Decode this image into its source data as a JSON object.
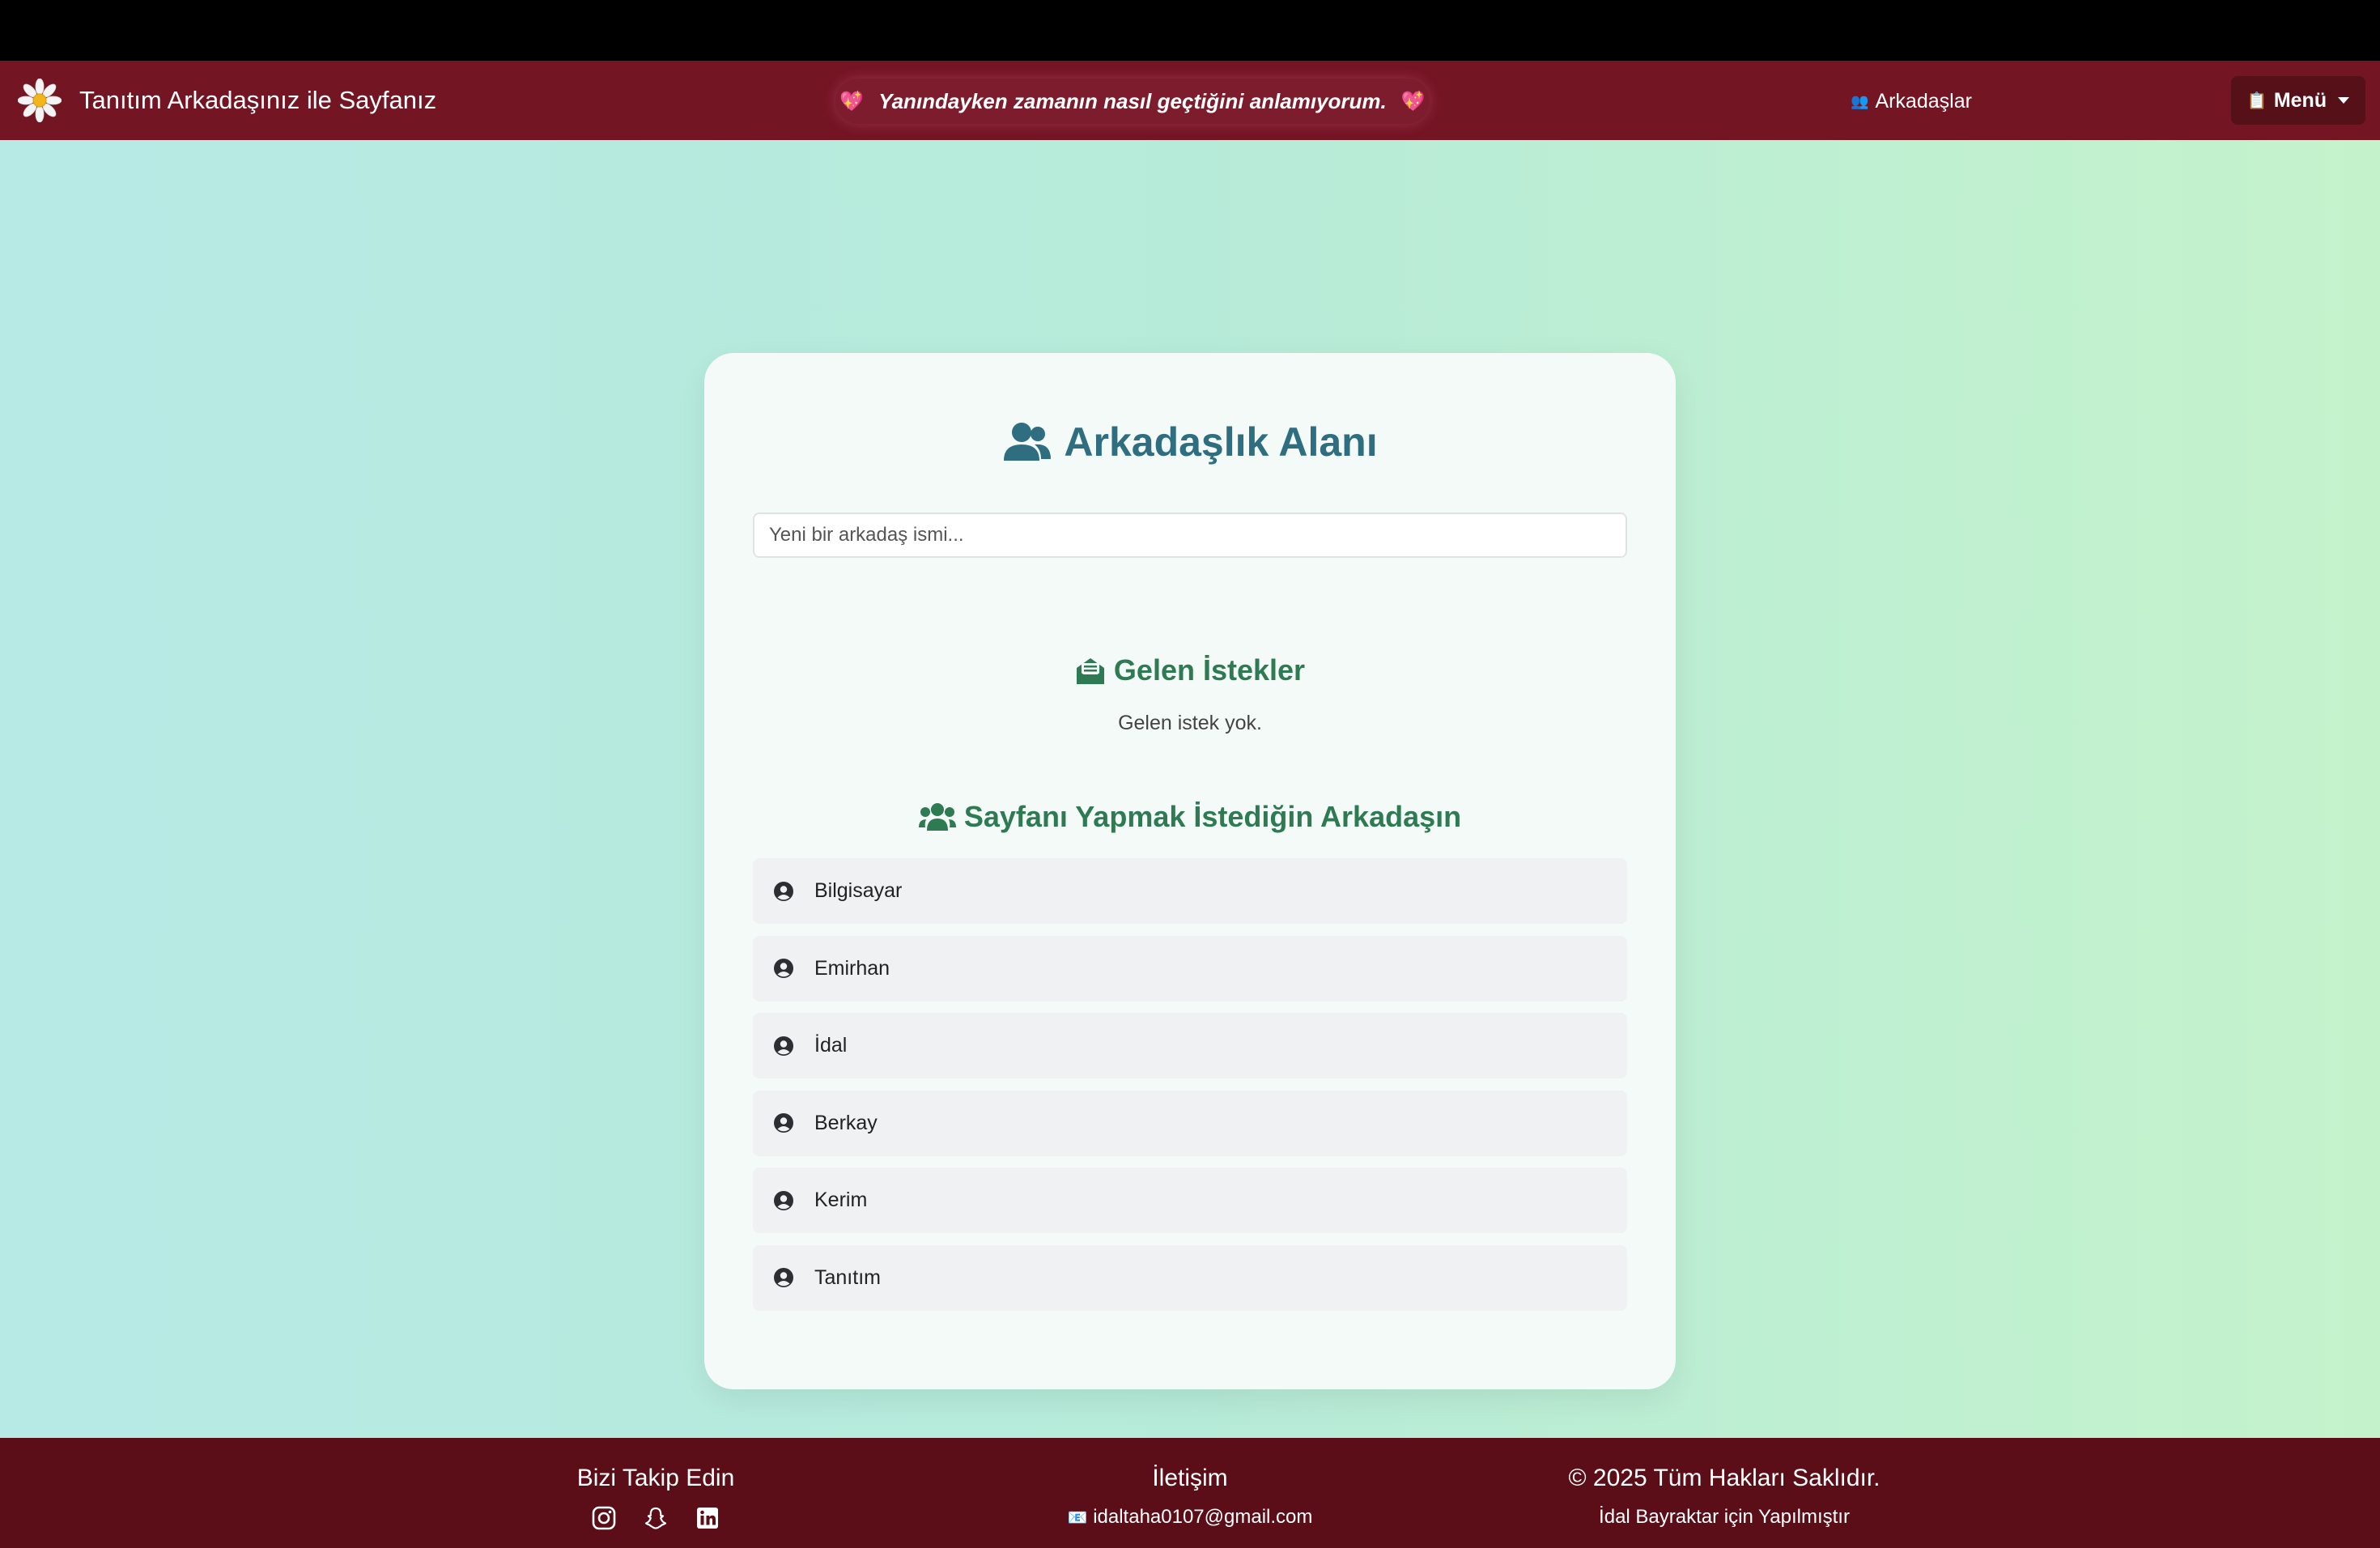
{
  "navbar": {
    "brand_title": "Tanıtım Arkadaşınız ile Sayfanız",
    "brand_icon": "daisy-flower-icon",
    "marquee_text": "Yanındayken zamanın nasıl geçtiğini anlamıyorum.",
    "marquee_heart": "💖",
    "friends_link_icon": "👥",
    "friends_link": "Arkadaşlar",
    "menu_icon": "📋",
    "menu_label": "Menü"
  },
  "card": {
    "title": "Arkadaşlık Alanı",
    "search_placeholder": "Yeni bir arkadaş ismi...",
    "incoming_title": "Gelen İstekler",
    "incoming_empty": "Gelen istek yok.",
    "friends_title": "Sayfanı Yapmak İstediğin Arkadaşın",
    "friends": [
      {
        "name": "Bilgisayar"
      },
      {
        "name": "Emirhan"
      },
      {
        "name": "İdal"
      },
      {
        "name": "Berkay"
      },
      {
        "name": "Kerim"
      },
      {
        "name": "Tanıtım"
      }
    ]
  },
  "footer": {
    "follow_title": "Bizi Takip Edin",
    "social": [
      "instagram-icon",
      "snapchat-icon",
      "linkedin-icon"
    ],
    "contact_title": "İletişim",
    "contact_icon": "📧",
    "contact_email": "idaltaha0107@gmail.com",
    "copyright": "© 2025 Tüm Hakları Saklıdır.",
    "made_for": "İdal Bayraktar için Yapılmıştır"
  },
  "colors": {
    "navbar": "#741524",
    "footer": "#5c0e18",
    "title": "#2e6e80",
    "section_title": "#2e7a52"
  }
}
